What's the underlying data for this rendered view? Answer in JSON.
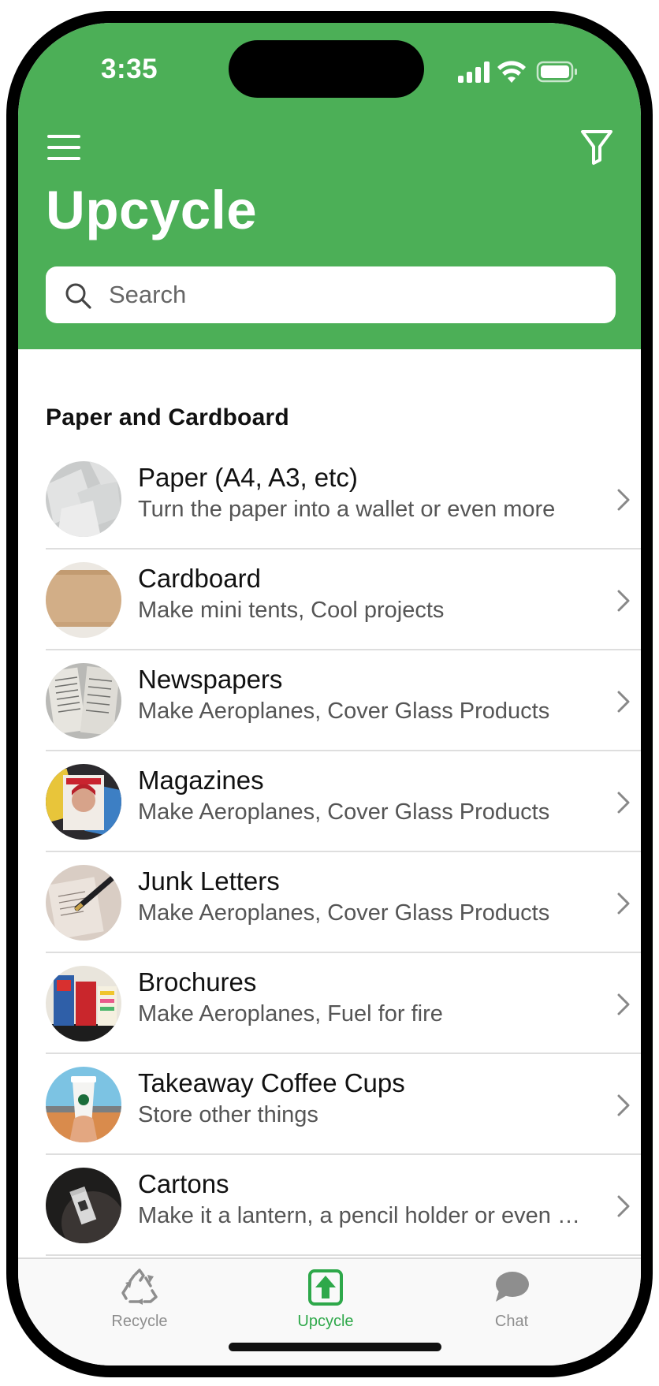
{
  "status_bar": {
    "time": "3:35"
  },
  "header": {
    "title": "Upcycle",
    "menu_icon": "hamburger-menu-icon",
    "filter_icon": "filter-funnel-icon",
    "background_color": "#4caf57"
  },
  "search": {
    "placeholder": "Search",
    "value": ""
  },
  "section": {
    "title": "Paper and Cardboard"
  },
  "items": [
    {
      "title": "Paper (A4, A3, etc)",
      "subtitle": "Turn the paper into a wallet or even more"
    },
    {
      "title": "Cardboard",
      "subtitle": "Make mini tents, Cool projects"
    },
    {
      "title": "Newspapers",
      "subtitle": "Make Aeroplanes, Cover Glass Products"
    },
    {
      "title": "Magazines",
      "subtitle": "Make Aeroplanes, Cover Glass Products"
    },
    {
      "title": "Junk Letters",
      "subtitle": "Make Aeroplanes, Cover Glass Products"
    },
    {
      "title": "Brochures",
      "subtitle": "Make Aeroplanes, Fuel for fire"
    },
    {
      "title": "Takeaway Coffee Cups",
      "subtitle": "Store other things"
    },
    {
      "title": "Cartons",
      "subtitle": "Make it a lantern, a pencil holder or even more"
    }
  ],
  "tabs": [
    {
      "label": "Recycle",
      "icon": "recycle-icon",
      "active": false
    },
    {
      "label": "Upcycle",
      "icon": "upcycle-arrow-icon",
      "active": true
    },
    {
      "label": "Chat",
      "icon": "chat-bubble-icon",
      "active": false
    }
  ],
  "colors": {
    "accent": "#4caf57",
    "active_tab": "#2ea84a",
    "inactive_tab": "#8e8e8e"
  }
}
